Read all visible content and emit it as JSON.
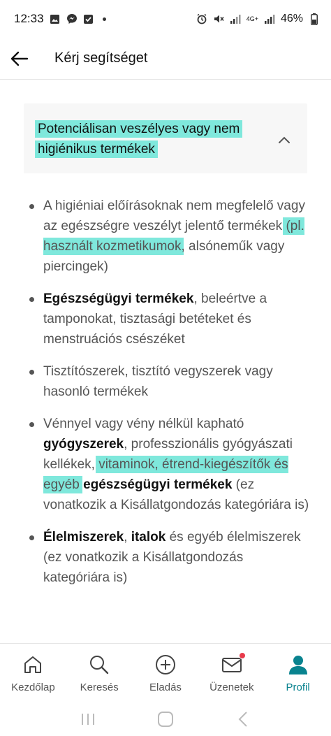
{
  "status_bar": {
    "time": "12:33",
    "network_tag": "4G+",
    "battery": "46%"
  },
  "app_bar": {
    "title": "Kérj segítséget"
  },
  "accordion": {
    "title_line1": "Potenciálisan veszélyes vagy nem",
    "title_line2": "higiénikus termékek"
  },
  "items": [
    {
      "t1": "A higiéniai előírásoknak nem megfelelő vagy az egészségre veszélyt jelentő termékek ",
      "hl1": "(pl. használt kozmetikumok",
      "t2": ", alsóneműk vagy piercingek)"
    },
    {
      "b1": "Egészségügyi termékek",
      "t1": ", beleértve a tamponokat, tisztasági betéteket és menstruációs csészéket"
    },
    {
      "t1": "Tisztítószerek, tisztító vegyszerek vagy hasonló termékek"
    },
    {
      "t1": "Vénnyel vagy vény nélkül kapható ",
      "b1": "gyógyszerek",
      "t2": ", professzionális gyógyászati kellékek, ",
      "hl1": "vitaminok, étrend-kiegészítők és egyéb",
      "t3": " ",
      "b2": "egészségügyi termékek",
      "t4": " (ez vonatkozik a Kisállatgondozás kategóriára is)"
    },
    {
      "b1": "Élelmiszerek",
      "t1": ", ",
      "b2": "italok",
      "t2": " és egyéb élelmiszerek (ez vonatkozik a Kisállatgondozás kategóriára is)"
    }
  ],
  "bottom_nav": [
    {
      "label": "Kezdőlap",
      "icon": "home-icon"
    },
    {
      "label": "Keresés",
      "icon": "search-icon"
    },
    {
      "label": "Eladás",
      "icon": "plus-circle-icon"
    },
    {
      "label": "Üzenetek",
      "icon": "mail-icon"
    },
    {
      "label": "Profil",
      "icon": "profile-icon",
      "active": true
    }
  ],
  "colors": {
    "accent": "#09838f",
    "highlight": "#7fe8dc",
    "badge": "#e83a4b"
  }
}
